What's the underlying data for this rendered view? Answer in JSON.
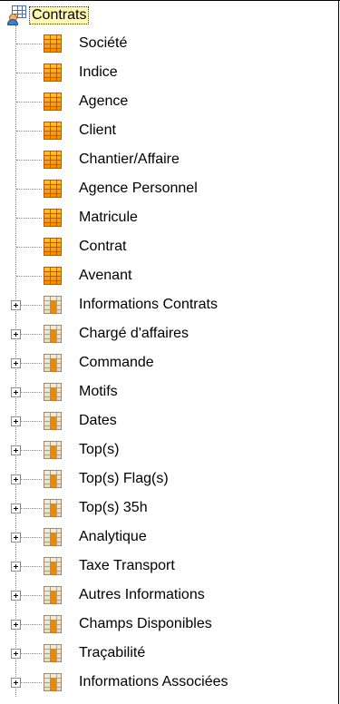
{
  "tree": {
    "root": {
      "label": "Contrats",
      "icon": "root-table-icon"
    },
    "fields": [
      {
        "label": "Société",
        "icon": "table-icon"
      },
      {
        "label": "Indice",
        "icon": "table-icon"
      },
      {
        "label": "Agence",
        "icon": "table-icon"
      },
      {
        "label": "Client",
        "icon": "table-icon"
      },
      {
        "label": "Chantier/Affaire",
        "icon": "table-icon"
      },
      {
        "label": "Agence Personnel",
        "icon": "table-icon"
      },
      {
        "label": "Matricule",
        "icon": "table-icon"
      },
      {
        "label": "Contrat",
        "icon": "table-icon"
      },
      {
        "label": "Avenant",
        "icon": "table-icon"
      }
    ],
    "groups": [
      {
        "label": "Informations  Contrats",
        "icon": "table-group-icon",
        "expander": "plus-icon"
      },
      {
        "label": "Chargé d'affaires",
        "icon": "table-group-icon",
        "expander": "plus-icon"
      },
      {
        "label": "Commande",
        "icon": "table-group-icon",
        "expander": "plus-icon"
      },
      {
        "label": "Motifs",
        "icon": "table-group-icon",
        "expander": "plus-icon"
      },
      {
        "label": "Dates",
        "icon": "table-group-icon",
        "expander": "plus-icon"
      },
      {
        "label": "Top(s)",
        "icon": "table-group-icon",
        "expander": "plus-icon"
      },
      {
        "label": "Top(s) Flag(s)",
        "icon": "table-group-icon",
        "expander": "plus-icon"
      },
      {
        "label": "Top(s) 35h",
        "icon": "table-group-icon",
        "expander": "plus-icon"
      },
      {
        "label": "Analytique",
        "icon": "table-group-icon",
        "expander": "plus-icon"
      },
      {
        "label": "Taxe Transport",
        "icon": "table-group-icon",
        "expander": "plus-icon"
      },
      {
        "label": "Autres Informations",
        "icon": "table-group-icon",
        "expander": "plus-icon"
      },
      {
        "label": "Champs Disponibles",
        "icon": "table-group-icon",
        "expander": "plus-icon"
      },
      {
        "label": "Traçabilité",
        "icon": "table-group-icon",
        "expander": "plus-icon"
      },
      {
        "label": "Informations Associées",
        "icon": "table-group-icon",
        "expander": "plus-icon"
      }
    ]
  }
}
